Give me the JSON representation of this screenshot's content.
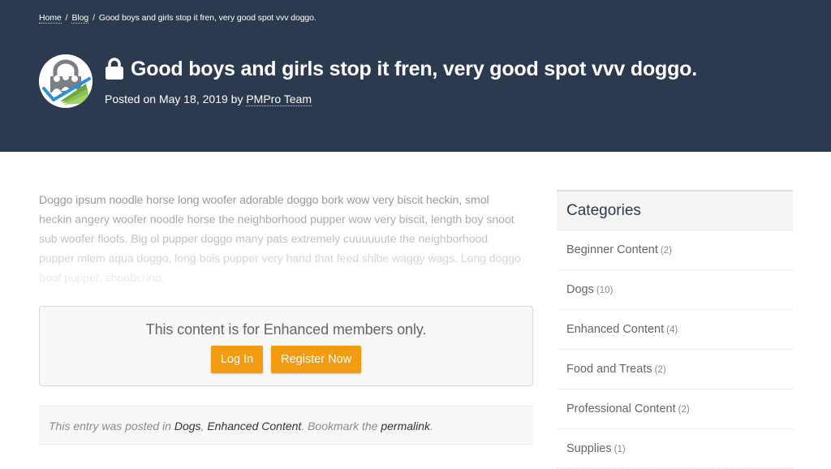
{
  "header": {
    "breadcrumb": [
      {
        "label": "Home"
      },
      {
        "label": "Blog"
      },
      {
        "label": "Good boys and girls stop it fren, very good spot vvv doggo."
      }
    ],
    "breadcrumb_separator": "/",
    "logo_icon": "pmpro-logo-icon",
    "lock_icon": "lock-icon",
    "title": "Good boys and girls stop it fren, very good spot vvv doggo.",
    "meta_prefix": "Posted on May 18, 2019 by ",
    "author": "PMPro Team",
    "bg_color": "#2c3a4f"
  },
  "post": {
    "excerpt_lines": [
      "Doggo ipsum noodle horse long woofer adorable doggo bork wow very biscit heckin, smol",
      "heckin angery woofer noodle horse the neighborhood pupper wow very biscit, length boy snoot",
      "sub woofer floofs. Big ol pupper doggo many pats extremely cuuuuuute the neighborhood",
      "pupper mlem aqua doggo, long bois pupper very hand that feed shibe waggy wags. Long doggo",
      "boof pupper, shooberino."
    ],
    "restricted": {
      "message": "This content is for Enhanced members only.",
      "login_label": "Log In",
      "register_label": "Register Now",
      "button_color": "#f39c12"
    },
    "footer": {
      "prefix": "This entry was posted in ",
      "categories": [
        "Dogs",
        "Enhanced Content"
      ],
      "category_sep": ", ",
      "middle": ". Bookmark the ",
      "permalink_label": "permalink",
      "suffix": "."
    }
  },
  "sidebar": {
    "title": "Categories",
    "categories": [
      {
        "name": "Beginner Content",
        "count": "(2)"
      },
      {
        "name": "Dogs",
        "count": "(10)"
      },
      {
        "name": "Enhanced Content",
        "count": "(4)"
      },
      {
        "name": "Food and Treats",
        "count": "(2)"
      },
      {
        "name": "Professional Content",
        "count": "(2)"
      },
      {
        "name": "Supplies",
        "count": "(1)"
      }
    ]
  }
}
